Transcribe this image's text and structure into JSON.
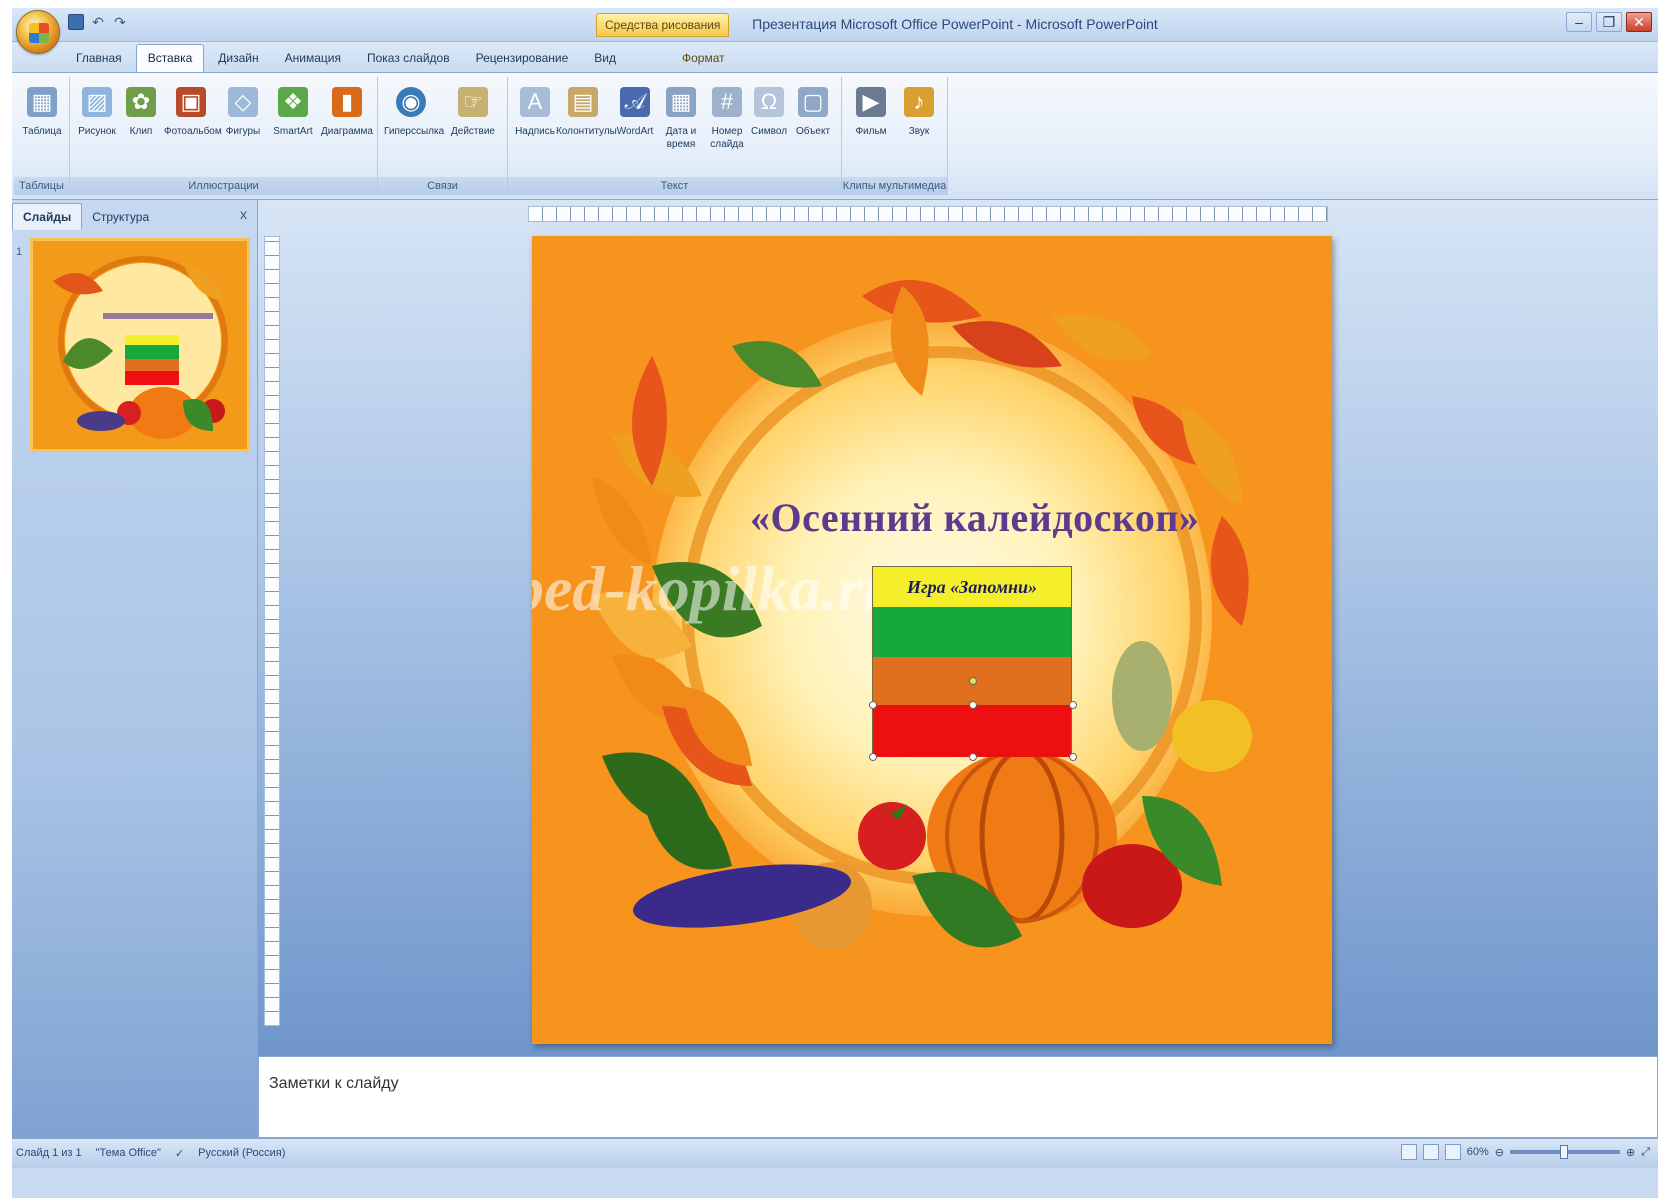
{
  "window": {
    "title": "Презентация Microsoft Office PowerPoint - Microsoft PowerPoint",
    "context_tab": "Средства рисования",
    "controls": {
      "minimize": "–",
      "maximize": "❐",
      "close": "✕"
    }
  },
  "ribbon": {
    "tabs": [
      "Главная",
      "Вставка",
      "Дизайн",
      "Анимация",
      "Показ слайдов",
      "Рецензирование",
      "Вид",
      "Формат"
    ],
    "active_tab": "Вставка",
    "groups": [
      {
        "label": "Таблицы",
        "buttons": [
          "Таблица"
        ]
      },
      {
        "label": "Иллюстрации",
        "buttons": [
          "Рисунок",
          "Клип",
          "Фотоальбом",
          "Фигуры",
          "SmartArt",
          "Диаграмма"
        ]
      },
      {
        "label": "Связи",
        "buttons": [
          "Гиперссылка",
          "Действие"
        ]
      },
      {
        "label": "Текст",
        "buttons": [
          "Надпись",
          "Колонтитулы",
          "WordArt",
          "Дата и время",
          "Номер слайда",
          "Символ",
          "Объект"
        ]
      },
      {
        "label": "Клипы мультимедиа",
        "buttons": [
          "Фильм",
          "Звук"
        ]
      }
    ]
  },
  "slides_pane": {
    "tabs": [
      "Слайды",
      "Структура"
    ],
    "close": "x",
    "slide_number": "1"
  },
  "slide": {
    "title": "«Осенний калейдоскоп»",
    "watermark": "ped-kopilka.ru",
    "game_label": "Игра «Запомни»"
  },
  "notes": {
    "placeholder": "Заметки к слайду"
  },
  "statusbar": {
    "slide_info": "Слайд 1 из 1",
    "theme": "\"Тема Office\"",
    "language": "Русский (Россия)",
    "zoom": "60%"
  }
}
